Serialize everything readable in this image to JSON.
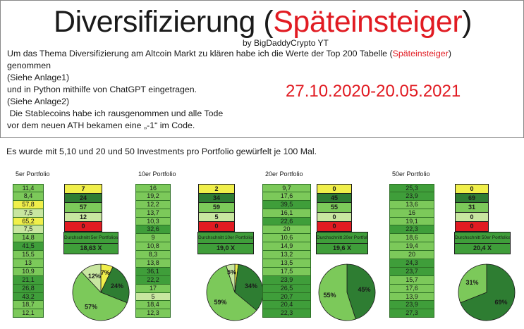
{
  "header": {
    "title_main": "Diversifizierung",
    "title_open": "(",
    "title_red": "Späteinsteiger",
    "title_close": ")",
    "byline": "by BigDaddyCrypto YT",
    "intro_1a": "Um das Thema Diversifizierung am Altcoin Markt zu klären habe ich die Werte der Top 200 Tabelle (",
    "intro_1b": "Späteinsteiger",
    "intro_1c": ")",
    "intro_2": "genommen",
    "intro_3": "(Siehe Anlage1)",
    "intro_4": "und in Python mithilfe von ChatGPT eingetragen.",
    "intro_5": "(Siehe Anlage2)",
    "intro_6": " Die Stablecoins habe ich rausgenommen und alle Tode",
    "intro_7": "vor dem neuen ATH bekamen eine „-1“ im Code.",
    "date_range": "27.10.2020-20.05.2021"
  },
  "subline": "Es wurde mit 5,10 und 20 und 50 Investments pro Portfolio gewürfelt je 100 Mal.",
  "colors": {
    "red": "#e11b22",
    "dark_green": "#2e7d32",
    "mid_green": "#3f9e3a",
    "light_green": "#7cc95a",
    "pale_green": "#c8e6a0",
    "yellow": "#f0ef4a"
  },
  "portfolios": [
    {
      "title": "5er Portfolio",
      "values": [
        "11,4",
        "8,4",
        "57,8",
        "7,5",
        "65,2",
        "7,5",
        "14,8",
        "41,5",
        "15,5",
        "13",
        "10,9",
        "21,1",
        "26,8",
        "43,2",
        "18,7",
        "12,1"
      ],
      "colors": [
        "light",
        "light",
        "yellow",
        "pale",
        "yellow",
        "pale",
        "light",
        "mid",
        "light",
        "light",
        "light",
        "mid",
        "mid",
        "mid",
        "light",
        "light"
      ],
      "counts": [
        "7",
        "24",
        "57",
        "12",
        "0"
      ],
      "avg_label": "Durchschnitt 5er Portfolios",
      "avg_value": "18,63  X",
      "pie": [
        {
          "pct": 7,
          "label": "7%",
          "color": "yellow"
        },
        {
          "pct": 24,
          "label": "24%",
          "color": "dark"
        },
        {
          "pct": 57,
          "label": "57%",
          "color": "light"
        },
        {
          "pct": 12,
          "label": "12%",
          "color": "pale"
        }
      ]
    },
    {
      "title": "10er Portfolio",
      "values": [
        "16",
        "19,2",
        "12,2",
        "13,7",
        "10,3",
        "32,6",
        "9",
        "10,8",
        "8,3",
        "13,8",
        "36,1",
        "22,2",
        "17",
        "5",
        "18,4",
        "12,3"
      ],
      "colors": [
        "light",
        "light",
        "light",
        "light",
        "light",
        "mid",
        "light",
        "light",
        "light",
        "light",
        "mid",
        "mid",
        "light",
        "pale",
        "light",
        "light"
      ],
      "counts": [
        "2",
        "34",
        "59",
        "5",
        "0"
      ],
      "avg_label": "Durchschnitt 10er Portfolios",
      "avg_value": "19,0  X",
      "pie": [
        {
          "pct": 2,
          "label": "",
          "color": "yellow"
        },
        {
          "pct": 34,
          "label": "34%",
          "color": "dark"
        },
        {
          "pct": 59,
          "label": "59%",
          "color": "light"
        },
        {
          "pct": 5,
          "label": "5%",
          "color": "pale"
        }
      ]
    },
    {
      "title": "20er Portfolio",
      "values": [
        "9,7",
        "17,6",
        "39,5",
        "16,1",
        "22,6",
        "20",
        "10,6",
        "14,9",
        "13,2",
        "13,5",
        "17,5",
        "23,9",
        "26,5",
        "20,7",
        "20,4",
        "22,3"
      ],
      "colors": [
        "light",
        "light",
        "mid",
        "light",
        "mid",
        "light",
        "light",
        "light",
        "light",
        "light",
        "light",
        "mid",
        "mid",
        "mid",
        "mid",
        "mid"
      ],
      "counts": [
        "0",
        "45",
        "55",
        "0",
        "0"
      ],
      "avg_label": "Durchschnitt 20er Portfolios",
      "avg_value": "19,6  X",
      "pie": [
        {
          "pct": 45,
          "label": "45%",
          "color": "dark"
        },
        {
          "pct": 55,
          "label": "55%",
          "color": "light"
        }
      ]
    },
    {
      "title": "50er Portfolio",
      "values": [
        "25,3",
        "23,9",
        "13,6",
        "16",
        "19,1",
        "22,3",
        "18,6",
        "19,4",
        "20",
        "24,3",
        "23,7",
        "15,7",
        "17,6",
        "13,9",
        "23,9",
        "27,3"
      ],
      "colors": [
        "mid",
        "mid",
        "light",
        "light",
        "light",
        "mid",
        "light",
        "light",
        "light",
        "mid",
        "mid",
        "light",
        "light",
        "light",
        "mid",
        "mid"
      ],
      "counts": [
        "0",
        "69",
        "31",
        "0",
        "0"
      ],
      "avg_label": "Durchschnitt 50er Portfolios",
      "avg_value": "20,4  X",
      "pie": [
        {
          "pct": 69,
          "label": "69%",
          "color": "dark"
        },
        {
          "pct": 31,
          "label": "31%",
          "color": "light"
        }
      ]
    }
  ]
}
